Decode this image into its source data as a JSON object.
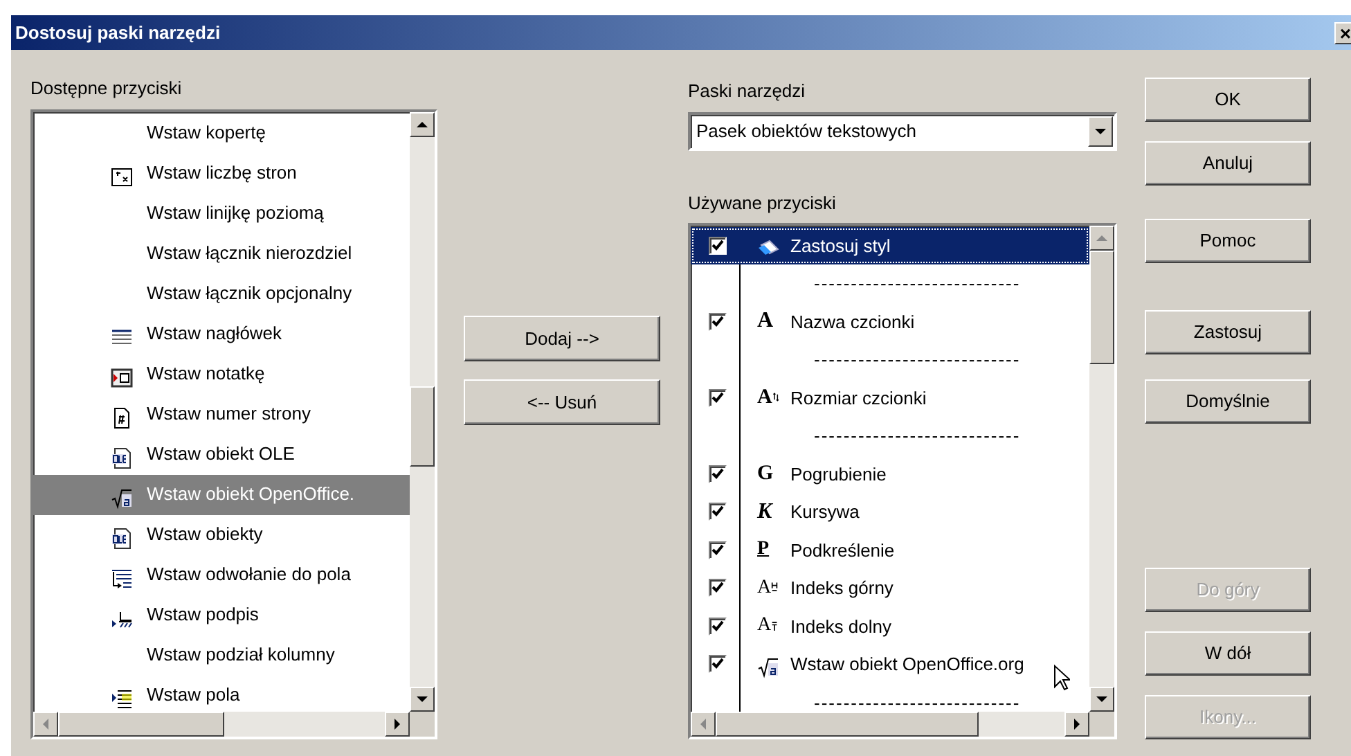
{
  "window": {
    "title": "Dostosuj paski narzędzi",
    "close": "×"
  },
  "available": {
    "label": "Dostępne przyciski",
    "items": [
      {
        "text": "Wstaw kopertę",
        "selected": false
      },
      {
        "text": "Wstaw liczbę stron",
        "selected": false
      },
      {
        "text": "Wstaw linijkę poziomą",
        "selected": false
      },
      {
        "text": "Wstaw łącznik nierozdziel",
        "selected": false
      },
      {
        "text": "Wstaw łącznik opcjonalny",
        "selected": false
      },
      {
        "text": "Wstaw nagłówek",
        "selected": false
      },
      {
        "text": "Wstaw notatkę",
        "selected": false
      },
      {
        "text": "Wstaw numer strony",
        "selected": false
      },
      {
        "text": "Wstaw obiekt OLE",
        "selected": false
      },
      {
        "text": "Wstaw obiekt OpenOffice.",
        "selected": true
      },
      {
        "text": "Wstaw obiekty",
        "selected": false
      },
      {
        "text": "Wstaw odwołanie do pola",
        "selected": false
      },
      {
        "text": "Wstaw podpis",
        "selected": false
      },
      {
        "text": "Wstaw podział kolumny",
        "selected": false
      },
      {
        "text": "Wstaw pola",
        "selected": false
      }
    ]
  },
  "move_buttons": [
    {
      "label": "Dodaj -->"
    },
    {
      "label": "<-- Usuń"
    }
  ],
  "toolbars": {
    "label": "Paski narzędzi",
    "value": "Pasek obiektów tekstowych"
  },
  "used": {
    "label": "Używane przyciski",
    "items": [
      {
        "kind": "button",
        "text": "Zastosuj styl",
        "checked": true,
        "selected": true
      },
      {
        "kind": "separator",
        "text": "----------------------------"
      },
      {
        "kind": "button",
        "glyph": "A",
        "text": "Nazwa czcionki",
        "checked": true,
        "selected": false
      },
      {
        "kind": "separator",
        "text": "----------------------------"
      },
      {
        "kind": "button",
        "glyph": "A",
        "text": "Rozmiar czcionki",
        "checked": true,
        "selected": false
      },
      {
        "kind": "separator",
        "text": "----------------------------"
      },
      {
        "kind": "button",
        "glyph": "G",
        "text": "Pogrubienie",
        "checked": true,
        "selected": false
      },
      {
        "kind": "button",
        "glyph": "K",
        "text": "Kursywa",
        "checked": true,
        "selected": false
      },
      {
        "kind": "button",
        "glyph": "P",
        "text": "Podkreślenie",
        "checked": true,
        "selected": false
      },
      {
        "kind": "button",
        "glyph": "A",
        "text": "Indeks górny",
        "checked": true,
        "selected": false
      },
      {
        "kind": "button",
        "glyph": "A",
        "text": "Indeks dolny",
        "checked": true,
        "selected": false
      },
      {
        "kind": "button",
        "text": "Wstaw obiekt OpenOffice.org",
        "checked": true,
        "selected": false
      },
      {
        "kind": "separator",
        "text": "----------------------------"
      }
    ]
  },
  "buttons": [
    {
      "label": "OK",
      "disabled": false
    },
    {
      "label": "Anuluj",
      "disabled": false
    },
    {
      "label": "Pomoc",
      "disabled": false
    },
    {
      "label": "Zastosuj",
      "disabled": false
    },
    {
      "label": "Domyślnie",
      "disabled": false
    },
    {
      "label": "Do góry",
      "disabled": true
    },
    {
      "label": "W dół",
      "disabled": false
    },
    {
      "label": "Ikony...",
      "disabled": true
    }
  ]
}
